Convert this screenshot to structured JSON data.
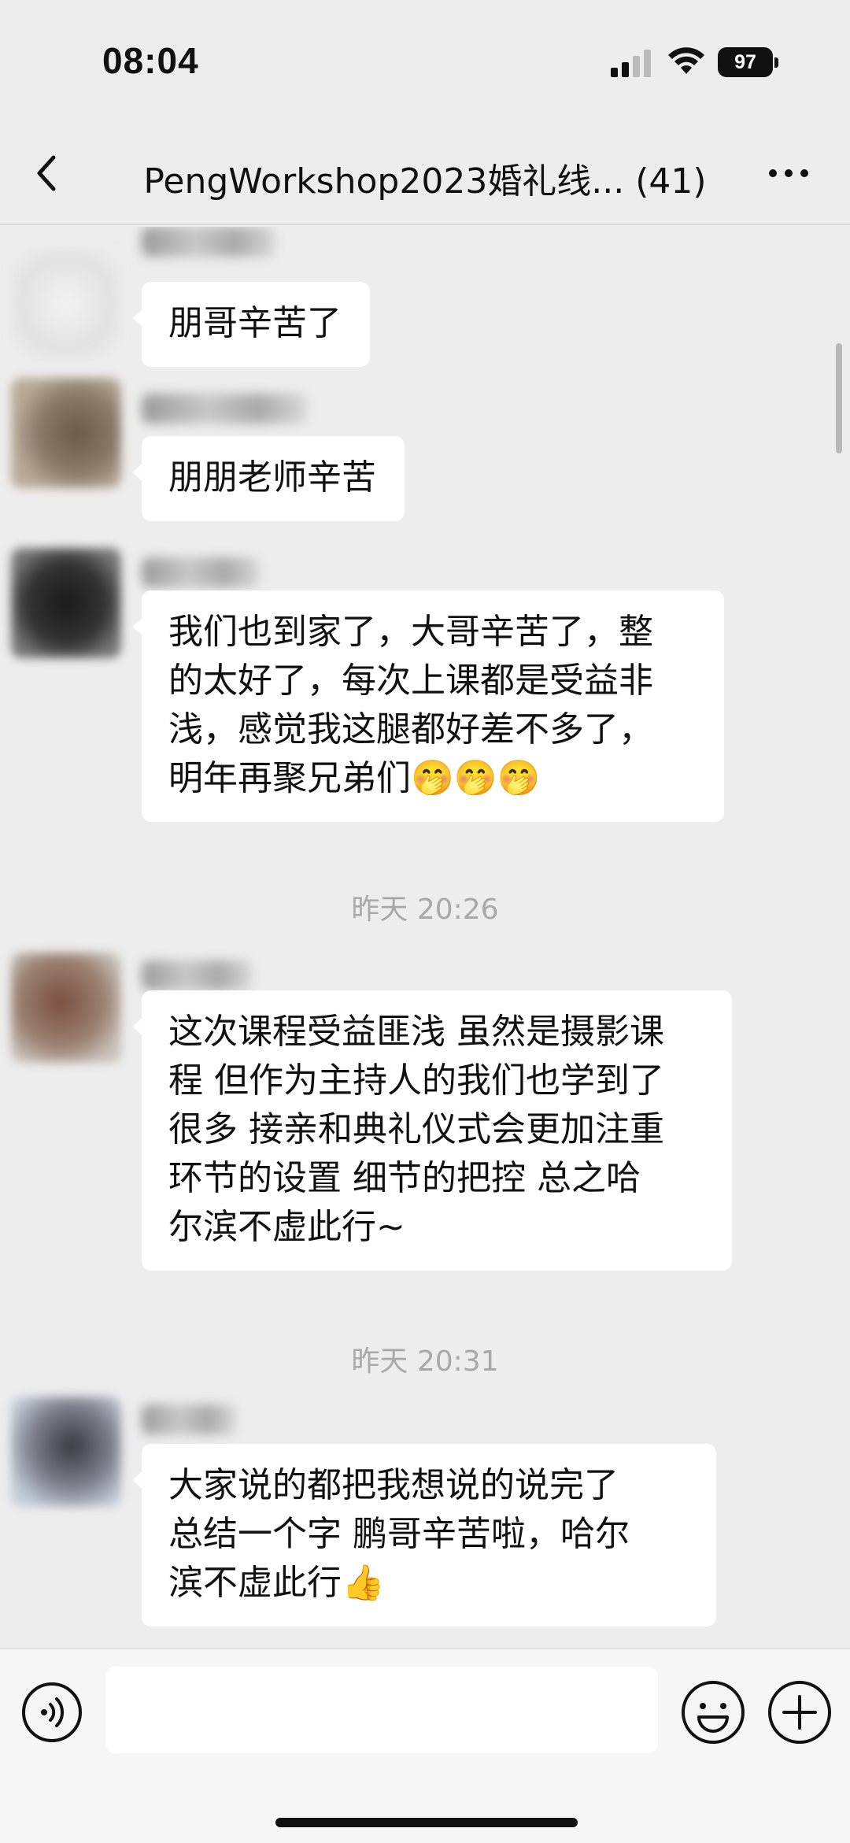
{
  "status_bar": {
    "time": "08:04",
    "battery": "97",
    "icons": [
      "cellular-signal-icon",
      "wifi-icon",
      "battery-icon"
    ]
  },
  "nav": {
    "title": "PengWorkshop2023婚礼线... (41)",
    "icons": [
      "back-chevron-icon",
      "more-dots-icon"
    ]
  },
  "messages": [
    {
      "type": "message",
      "lines": [
        "朋哥辛苦了"
      ]
    },
    {
      "type": "message",
      "lines": [
        "朋朋老师辛苦"
      ]
    },
    {
      "type": "message",
      "lines": [
        "我们也到家了，大哥辛苦了，整",
        "的太好了，每次上课都是受益非",
        "浅，感觉我这腿都好差不多了，",
        "明年再聚兄弟们🤭🤭🤭"
      ]
    },
    {
      "type": "timestamp",
      "text": "昨天 20:26"
    },
    {
      "type": "message",
      "lines": [
        "这次课程受益匪浅 虽然是摄影课",
        "程 但作为主持人的我们也学到了",
        "很多 接亲和典礼仪式会更加注重",
        "环节的设置 细节的把控 总之哈",
        "尔滨不虚此行~"
      ]
    },
    {
      "type": "timestamp",
      "text": "昨天 20:31"
    },
    {
      "type": "message",
      "lines": [
        "大家说的都把我想说的说完了",
        "总结一个字  鹏哥辛苦啦，哈尔",
        "滨不虚此行👍"
      ]
    }
  ],
  "input_bar": {
    "placeholder": "",
    "value": "",
    "icons": [
      "voice-icon",
      "emoji-icon",
      "plus-icon"
    ]
  },
  "colors": {
    "background": "#ededed",
    "bubble": "#ffffff",
    "timestamp_text": "#a8a8a8"
  }
}
